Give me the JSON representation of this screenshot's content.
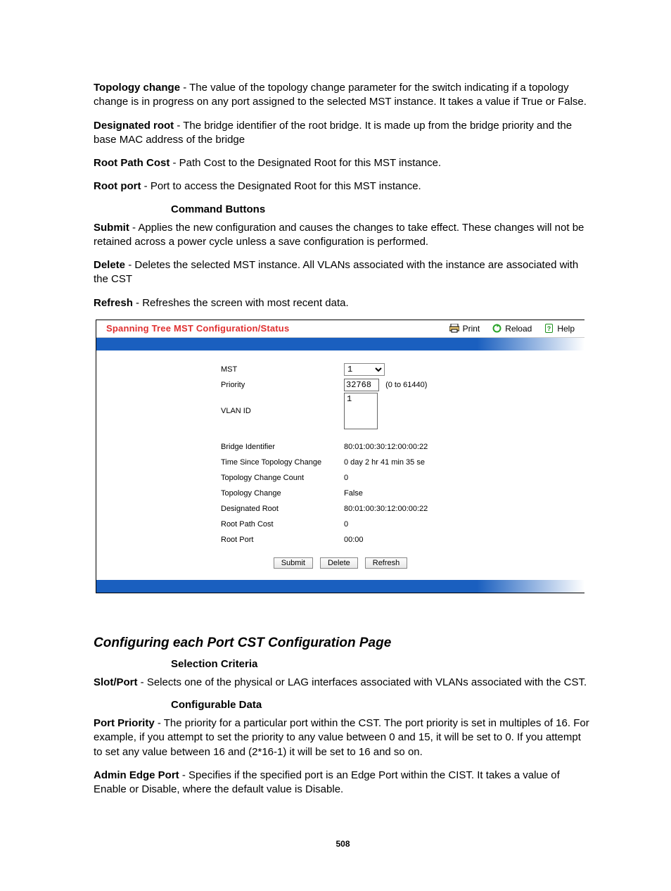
{
  "paras": {
    "topology_change": {
      "term": "Topology change",
      "text": " - The value of the topology change parameter for the switch indicating if a topology change is in progress on any port assigned to the selected MST instance. It takes a value if True or False."
    },
    "designated_root": {
      "term": "Designated root",
      "text": " - The bridge identifier of the root bridge. It is made up from the bridge priority and the base MAC address of the bridge"
    },
    "root_path_cost": {
      "term": "Root Path Cost",
      "text": " - Path Cost to the Designated Root for this MST instance."
    },
    "root_port": {
      "term": "Root port",
      "text": " - Port to access the Designated Root for this MST instance."
    },
    "command_buttons_head": "Command Buttons",
    "submit": {
      "term": "Submit",
      "text": " - Applies the new configuration and causes the changes to take effect. These changes will not be retained across a power cycle unless a save configuration is performed."
    },
    "delete": {
      "term": "Delete",
      "text": " - Deletes the selected MST instance. All VLANs associated with the instance are associated with the CST"
    },
    "refresh": {
      "term": "Refresh",
      "text": " - Refreshes the screen with most recent data."
    }
  },
  "shot": {
    "title": "Spanning Tree MST Configuration/Status",
    "actions": {
      "print": "Print",
      "reload": "Reload",
      "help": "Help"
    },
    "fields": {
      "mst_label": "MST",
      "mst_value": "1",
      "priority_label": "Priority",
      "priority_value": "32768",
      "priority_range": "(0 to 61440)",
      "vlan_label": "VLAN ID",
      "vlan_value": "1",
      "bridge_id_label": "Bridge Identifier",
      "bridge_id_value": "80:01:00:30:12:00:00:22",
      "tstc_label": "Time Since Topology Change",
      "tstc_value": "0 day 2 hr 41 min 35 se",
      "tcc_label": "Topology Change Count",
      "tcc_value": "0",
      "tc_label": "Topology Change",
      "tc_value": "False",
      "dr_label": "Designated Root",
      "dr_value": "80:01:00:30:12:00:00:22",
      "rpc_label": "Root Path Cost",
      "rpc_value": "0",
      "rp_label": "Root Port",
      "rp_value": "00:00"
    },
    "buttons": {
      "submit": "Submit",
      "delete": "Delete",
      "refresh": "Refresh"
    }
  },
  "section2": {
    "title": "Configuring each Port CST Configuration Page",
    "selection_head": "Selection Criteria",
    "slot_port": {
      "term": "Slot/Port",
      "text": " - Selects one of the physical or LAG interfaces associated with VLANs associated with the CST."
    },
    "config_head": "Configurable Data",
    "port_priority": {
      "term": "Port Priority",
      "text": " - The priority for a particular port within the CST. The port priority is set in multiples of 16. For example, if you attempt to set the priority to any value between 0 and 15, it will be set to 0. If you attempt to set any value between 16 and (2*16-1) it will be set to 16 and so on."
    },
    "admin_edge": {
      "term": "Admin Edge Port",
      "text": " - Specifies if the specified port is an Edge Port within the CIST. It takes a value of Enable or Disable, where the default value is Disable."
    }
  },
  "page_number": "508"
}
